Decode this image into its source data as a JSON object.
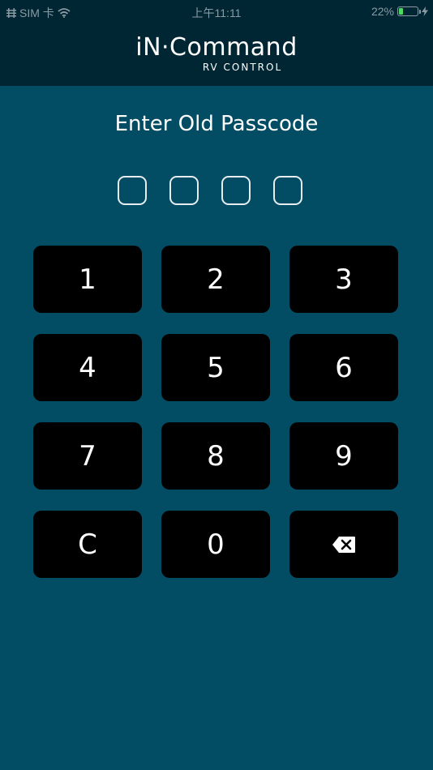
{
  "status_bar": {
    "carrier": "SIM 卡",
    "time": "上午11:11",
    "battery_percent": "22%",
    "battery_level": 0.22,
    "icons": [
      "signal-icon",
      "wifi-icon",
      "battery-icon",
      "charging-bolt-icon"
    ]
  },
  "header": {
    "logo_main": "iN·Command",
    "logo_sub": "RV CONTROL"
  },
  "passcode": {
    "prompt": "Enter Old Passcode",
    "digits_entered": 0,
    "digits_total": 4
  },
  "keypad": {
    "keys": [
      "1",
      "2",
      "3",
      "4",
      "5",
      "6",
      "7",
      "8",
      "9",
      "C",
      "0"
    ],
    "backspace_icon": "backspace-icon"
  },
  "colors": {
    "background": "#034d64",
    "header_background": "#002633",
    "key_background": "#000000",
    "text": "#ffffff",
    "battery_fill": "#4cd964"
  }
}
